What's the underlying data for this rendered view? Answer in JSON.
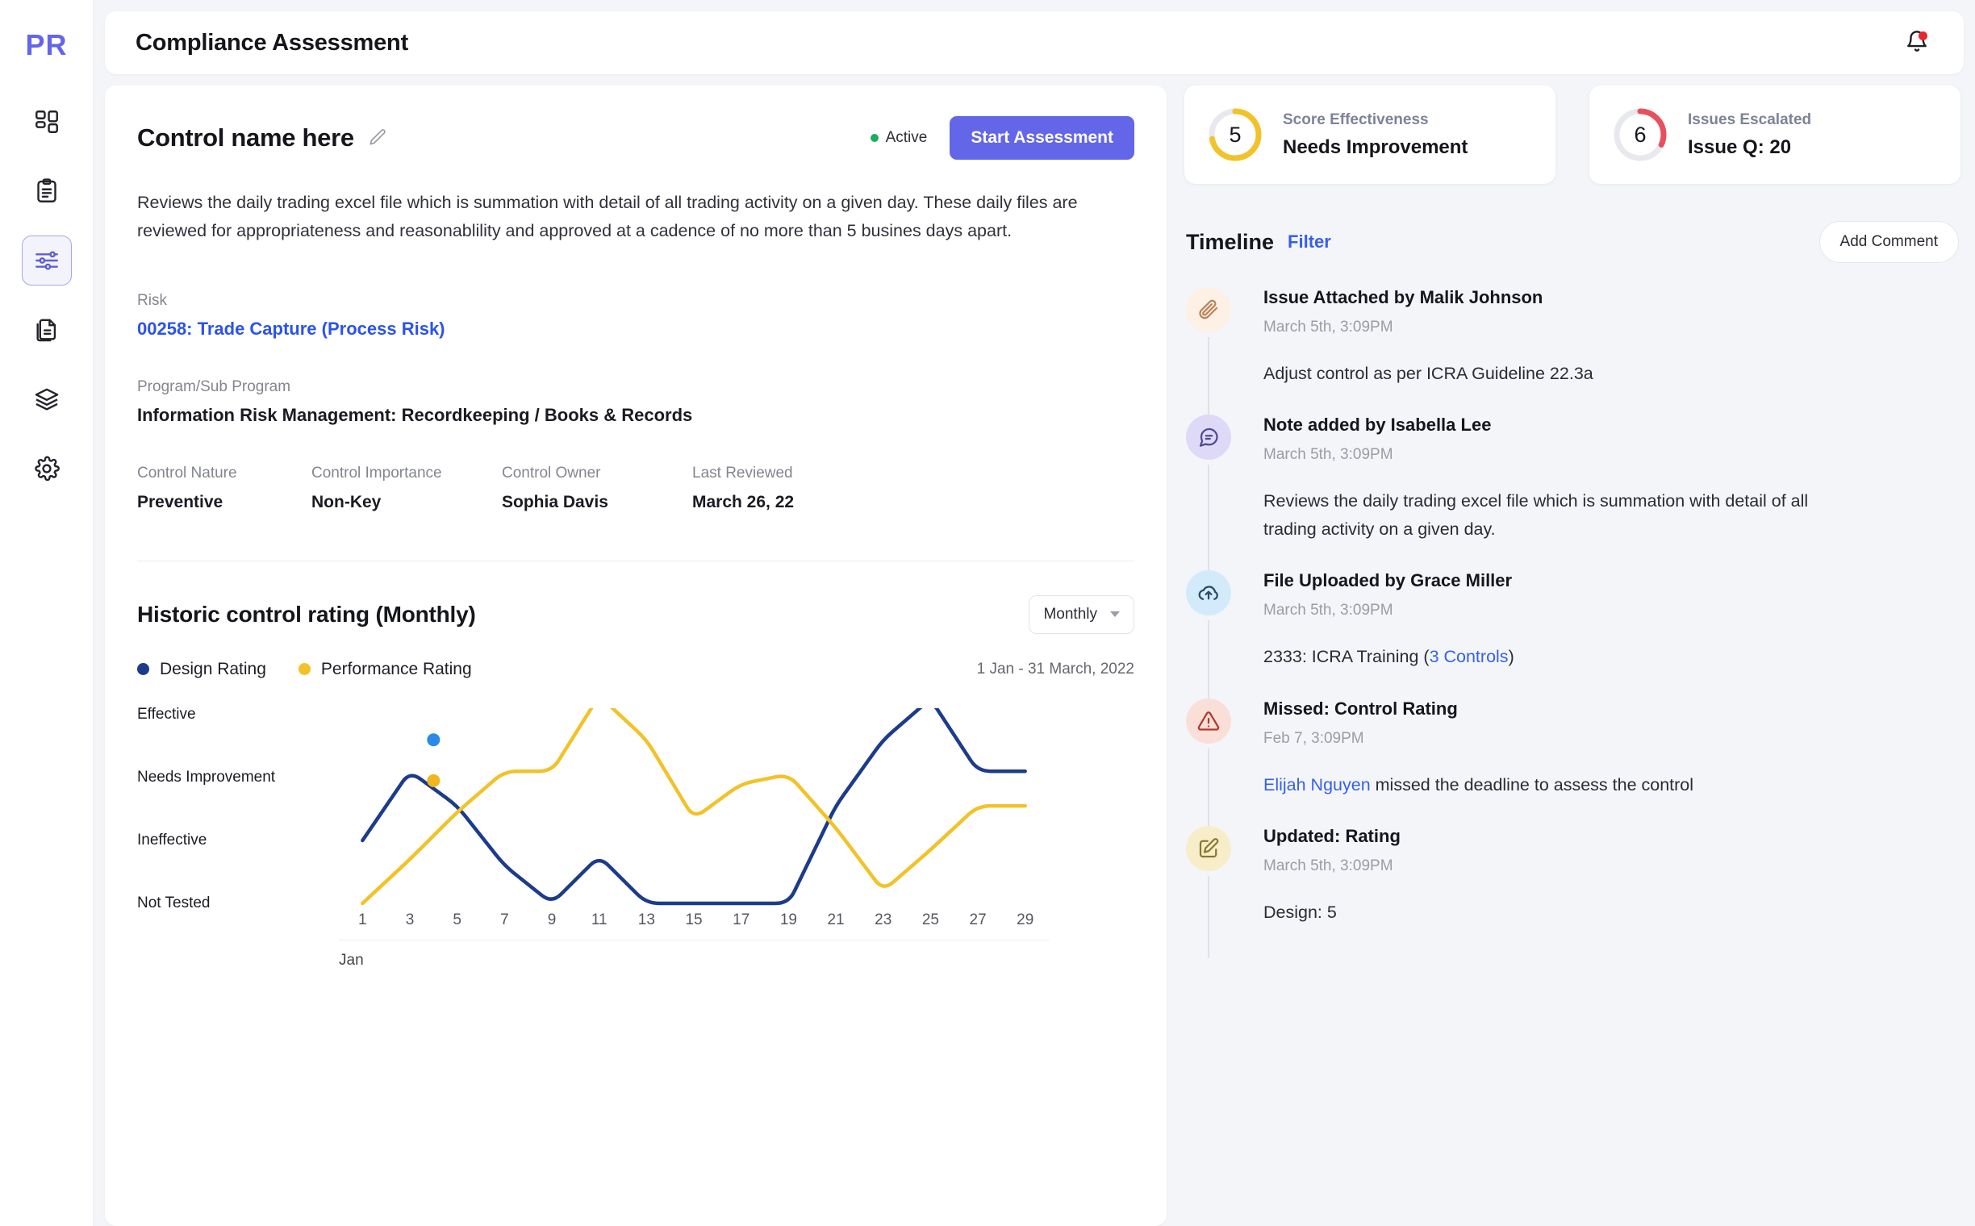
{
  "rail": {
    "logo": "PR",
    "items": [
      {
        "icon": "grid-icon",
        "name": "dashboard",
        "active": false
      },
      {
        "icon": "clipboard-icon",
        "name": "tasks",
        "active": false
      },
      {
        "icon": "sliders-icon",
        "name": "controls",
        "active": true
      },
      {
        "icon": "documents-icon",
        "name": "documents",
        "active": false
      },
      {
        "icon": "layers-icon",
        "name": "library",
        "active": false
      },
      {
        "icon": "gear-icon",
        "name": "settings",
        "active": false
      }
    ]
  },
  "topbar": {
    "title": "Compliance Assessment",
    "bell_icon": "bell-icon",
    "has_notification": true
  },
  "control": {
    "title": "Control name here",
    "edit_icon": "pencil-icon",
    "status": "Active",
    "status_color": "#1aac5f",
    "primary_button": "Start Assessment",
    "description": "Reviews the daily trading excel file which is summation with detail of all trading activity on a given day. These daily files are reviewed for appropriateness and reasonablility and approved at a cadence of no more than 5 busines days apart.",
    "risk_label": "Risk",
    "risk_value": "00258: Trade Capture (Process Risk)",
    "program_label": "Program/Sub Program",
    "program_value": "Information Risk Management: Recordkeeping / Books & Records",
    "meta": [
      {
        "label": "Control Nature",
        "value": "Preventive"
      },
      {
        "label": "Control Importance",
        "value": "Non-Key"
      },
      {
        "label": "Control Owner",
        "value": "Sophia Davis"
      },
      {
        "label": "Last Reviewed",
        "value": "March 26, 22"
      }
    ]
  },
  "chart_section": {
    "title": "Historic control rating (Monthly)",
    "period_select": "Monthly",
    "range": "1 Jan  - 31 March, 2022"
  },
  "chart_data": {
    "type": "line",
    "title": "Historic control rating (Monthly)",
    "xlabel": "Jan",
    "ylabel": "",
    "grid": false,
    "legend_position": "top-left",
    "y_categories": [
      "Not Tested",
      "Ineffective",
      "Needs Improvement",
      "Effective"
    ],
    "x_ticks": [
      1,
      3,
      5,
      7,
      9,
      11,
      13,
      15,
      17,
      19,
      21,
      23,
      25,
      27,
      29
    ],
    "x": [
      1,
      3,
      5,
      7,
      9,
      11,
      13,
      15,
      17,
      19,
      21,
      23,
      25,
      27,
      29
    ],
    "series": [
      {
        "name": "Design Rating",
        "color": "#1c3b8b",
        "values": [
          1.0,
          2.1,
          1.55,
          0.6,
          0.0,
          0.75,
          0.0,
          0.0,
          0.0,
          0.0,
          1.55,
          2.6,
          3.25,
          2.1,
          2.1
        ]
      },
      {
        "name": "Performance Rating",
        "color": "#f2c229",
        "values": [
          0.0,
          0.7,
          1.45,
          2.1,
          2.1,
          3.3,
          2.6,
          1.35,
          1.9,
          2.05,
          1.2,
          0.2,
          0.85,
          1.55,
          1.55
        ]
      }
    ],
    "markers": [
      {
        "series": "Design Rating",
        "color": "#2b8ae8",
        "x": 4,
        "y": 2.6
      },
      {
        "series": "Performance Rating",
        "color": "#f2b71e",
        "x": 4,
        "y": 1.95
      }
    ]
  },
  "scorecards": [
    {
      "value": "5",
      "label": "Score Effectiveness",
      "status": "Needs Improvement",
      "color": "#f2c229",
      "track": "#e8e9ee",
      "percent": 72
    },
    {
      "value": "6",
      "label": "Issues Escalated",
      "status": "Issue Q: 20",
      "color": "#e8505e",
      "track": "#e8e9ee",
      "percent": 32
    }
  ],
  "timeline": {
    "title": "Timeline",
    "filter": "Filter",
    "add_comment": "Add Comment",
    "items": [
      {
        "icon": "paperclip-icon",
        "badge_bg": "#fdf0e4",
        "icon_color": "#b5855c",
        "title": "Issue Attached by Malik Johnson",
        "time": "March 5th, 3:09PM",
        "body": "Adjust control as per ICRA Guideline 22.3a",
        "link_text": "",
        "body_after": ""
      },
      {
        "icon": "chat-icon",
        "badge_bg": "#ddd9f7",
        "icon_color": "#4f4a92",
        "title": "Note added by Isabella Lee",
        "time": "March 5th, 3:09PM",
        "body": "Reviews the daily trading excel file which is summation with detail of all trading activity on a given day.",
        "link_text": "",
        "body_after": ""
      },
      {
        "icon": "cloud-upload-icon",
        "badge_bg": "#d3eafb",
        "icon_color": "#2b4a63",
        "title": "File Uploaded by Grace Miller",
        "time": "March 5th, 3:09PM",
        "body": "2333: ICRA Training (",
        "link_text": "3 Controls",
        "body_after": ")"
      },
      {
        "icon": "warning-icon",
        "badge_bg": "#fadfd9",
        "icon_color": "#b33a2a",
        "title": "Missed: Control Rating",
        "time": "Feb 7, 3:09PM",
        "body": "",
        "link_text": "Elijah Nguyen",
        "body_after": " missed the deadline to assess the control"
      },
      {
        "icon": "edit-square-icon",
        "badge_bg": "#f7eec9",
        "icon_color": "#8a7730",
        "title": "Updated: Rating",
        "time": "March 5th, 3:09PM",
        "body": "Design: 5",
        "link_text": "",
        "body_after": ""
      }
    ]
  }
}
